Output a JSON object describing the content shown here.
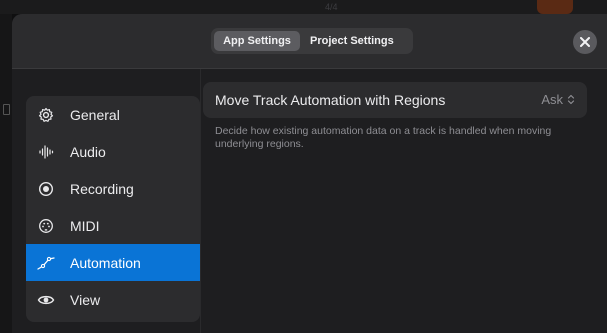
{
  "backdrop": {
    "partial_text": "4/4"
  },
  "header": {
    "tabs": [
      {
        "label": "App Settings",
        "active": true
      },
      {
        "label": "Project Settings",
        "active": false
      }
    ],
    "close_icon": "close-icon"
  },
  "sidebar": {
    "items": [
      {
        "label": "General",
        "icon": "gear-icon",
        "selected": false
      },
      {
        "label": "Audio",
        "icon": "waveform-icon",
        "selected": false
      },
      {
        "label": "Recording",
        "icon": "record-icon",
        "selected": false
      },
      {
        "label": "MIDI",
        "icon": "midi-icon",
        "selected": false
      },
      {
        "label": "Automation",
        "icon": "automation-icon",
        "selected": true
      },
      {
        "label": "View",
        "icon": "eye-icon",
        "selected": false
      }
    ]
  },
  "setting": {
    "title": "Move Track Automation with Regions",
    "value": "Ask",
    "description": "Decide how existing automation data on a track is handled when moving underlying regions."
  },
  "colors": {
    "accent": "#0a74d6",
    "panel": "#1e1e20",
    "card": "#2c2c2e"
  }
}
